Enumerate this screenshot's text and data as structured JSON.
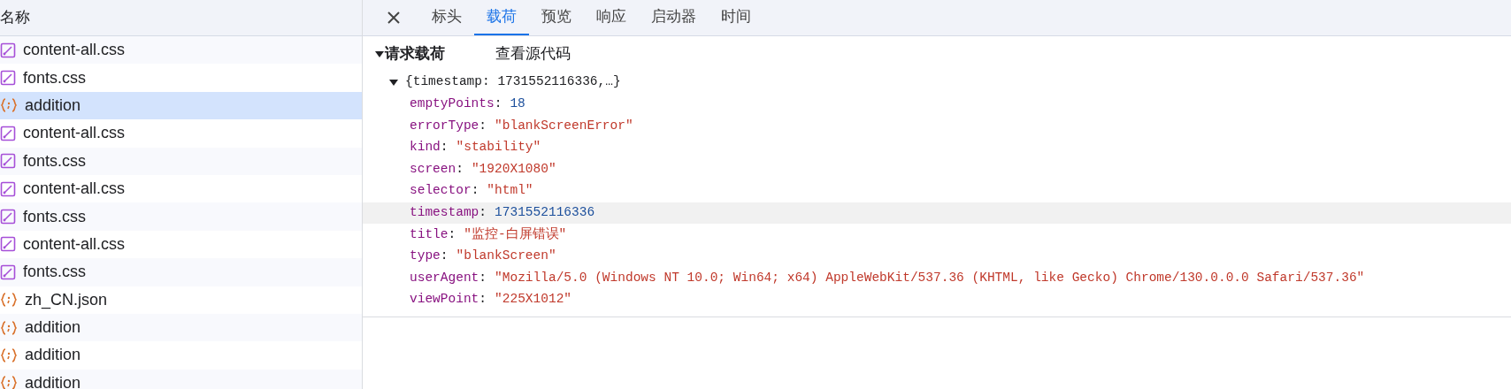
{
  "request_list": {
    "header": "名称",
    "rows": [
      {
        "name": "content-all.css",
        "kind": "css",
        "selected": false
      },
      {
        "name": "fonts.css",
        "kind": "css",
        "selected": false
      },
      {
        "name": "addition",
        "kind": "json",
        "selected": true
      },
      {
        "name": "content-all.css",
        "kind": "css",
        "selected": false
      },
      {
        "name": "fonts.css",
        "kind": "css",
        "selected": false
      },
      {
        "name": "content-all.css",
        "kind": "css",
        "selected": false
      },
      {
        "name": "fonts.css",
        "kind": "css",
        "selected": false
      },
      {
        "name": "content-all.css",
        "kind": "css",
        "selected": false
      },
      {
        "name": "fonts.css",
        "kind": "css",
        "selected": false
      },
      {
        "name": "zh_CN.json",
        "kind": "json",
        "selected": false
      },
      {
        "name": "addition",
        "kind": "json",
        "selected": false
      },
      {
        "name": "addition",
        "kind": "json",
        "selected": false
      },
      {
        "name": "addition",
        "kind": "json",
        "selected": false
      }
    ]
  },
  "tabs": [
    {
      "label": "标头",
      "selected": false
    },
    {
      "label": "载荷",
      "selected": true
    },
    {
      "label": "预览",
      "selected": false
    },
    {
      "label": "响应",
      "selected": false
    },
    {
      "label": "启动器",
      "selected": false
    },
    {
      "label": "时间",
      "selected": false
    }
  ],
  "payload": {
    "section_title": "请求载荷",
    "expanded": true,
    "view_source": "查看源代码",
    "summary": "{timestamp: 1731552116336,…}",
    "object_expanded": true,
    "key_separator": ":",
    "properties": [
      {
        "key": "emptyPoints",
        "value": "18",
        "kind": "number",
        "hovered": false
      },
      {
        "key": "errorType",
        "value": "\"blankScreenError\"",
        "kind": "string",
        "hovered": false
      },
      {
        "key": "kind",
        "value": "\"stability\"",
        "kind": "string",
        "hovered": false
      },
      {
        "key": "screen",
        "value": "\"1920X1080\"",
        "kind": "string",
        "hovered": false
      },
      {
        "key": "selector",
        "value": "\"html\"",
        "kind": "string",
        "hovered": false
      },
      {
        "key": "timestamp",
        "value": "1731552116336",
        "kind": "number",
        "hovered": true
      },
      {
        "key": "title",
        "value": "\"监控-白屏错误\"",
        "kind": "string",
        "hovered": false
      },
      {
        "key": "type",
        "value": "\"blankScreen\"",
        "kind": "string",
        "hovered": false
      },
      {
        "key": "userAgent",
        "value": "\"Mozilla/5.0 (Windows NT 10.0; Win64; x64) AppleWebKit/537.36 (KHTML, like Gecko) Chrome/130.0.0.0 Safari/537.36\"",
        "kind": "string",
        "hovered": false
      },
      {
        "key": "viewPoint",
        "value": "\"225X1012\"",
        "kind": "string",
        "hovered": false
      }
    ]
  }
}
